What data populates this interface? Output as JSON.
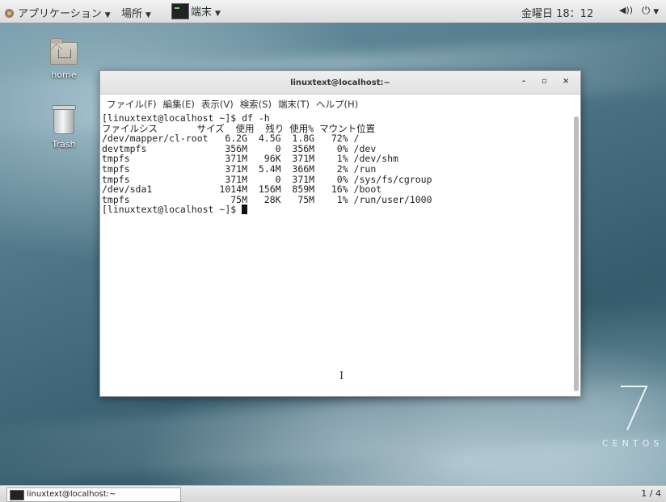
{
  "topbar": {
    "applications": "アプリケーション",
    "places": "場所",
    "terminal": "端末",
    "clock": "金曜日 18：12"
  },
  "desktop": {
    "icons": [
      {
        "label": "home"
      },
      {
        "label": "Trash"
      }
    ],
    "logo_number": "7",
    "logo_text": "CENTOS"
  },
  "window": {
    "title": "linuxtext@localhost:~",
    "controls": {
      "minimize": "-",
      "maximize": "▫",
      "close": "×"
    },
    "menu": [
      "ファイル(F)",
      "編集(E)",
      "表示(V)",
      "検索(S)",
      "端末(T)",
      "ヘルプ(H)"
    ],
    "prompt": "[linuxtext@localhost ~]$ ",
    "lines": [
      "[linuxtext@localhost ~]$ df -h",
      "ファイルシス       サイズ  使用  残り 使用% マウント位置",
      "/dev/mapper/cl-root   6.2G  4.5G  1.8G   72% /",
      "devtmpfs              356M     0  356M    0% /dev",
      "tmpfs                 371M   96K  371M    1% /dev/shm",
      "tmpfs                 371M  5.4M  366M    2% /run",
      "tmpfs                 371M     0  371M    0% /sys/fs/cgroup",
      "/dev/sda1            1014M  156M  859M   16% /boot",
      "tmpfs                  75M   28K   75M    1% /run/user/1000"
    ]
  },
  "bottombar": {
    "task_label": "linuxtext@localhost:~",
    "workspace": "1 / 4"
  }
}
